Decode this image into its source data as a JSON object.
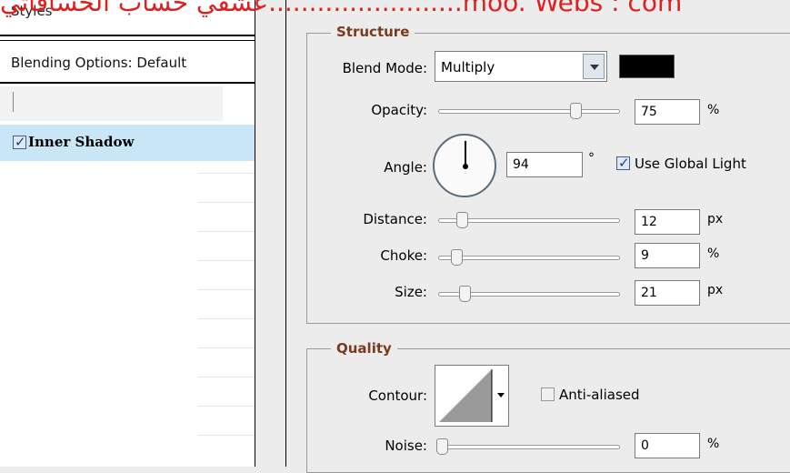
{
  "watermark": "عشقي حساب الحسافاتي........................moo. Webs : com",
  "styles_panel": {
    "title": "Styles",
    "blending_options": "Blending Options: Default",
    "placeholder_row": "[",
    "inner_shadow": {
      "label": "Inner Shadow",
      "checked": true
    }
  },
  "structure": {
    "title": "Structure",
    "blend_mode": {
      "label": "Blend Mode:",
      "value": "Multiply",
      "color": "#000000"
    },
    "opacity": {
      "label": "Opacity:",
      "value": "75",
      "unit": "%",
      "level": 0.75
    },
    "angle": {
      "label": "Angle:",
      "value": "94",
      "unit": "°",
      "use_global_light_label": "Use Global Light",
      "use_global_light": true
    },
    "distance": {
      "label": "Distance:",
      "value": "12",
      "unit": "px",
      "level": 0.12
    },
    "choke": {
      "label": "Choke:",
      "value": "9",
      "unit": "%",
      "level": 0.09
    },
    "size": {
      "label": "Size:",
      "value": "21",
      "unit": "px",
      "level": 0.12
    }
  },
  "quality": {
    "title": "Quality",
    "contour": {
      "label": "Contour:"
    },
    "anti_aliased": {
      "label": "Anti-aliased",
      "checked": false
    },
    "noise": {
      "label": "Noise:",
      "value": "0",
      "unit": "%",
      "level": 0
    }
  }
}
